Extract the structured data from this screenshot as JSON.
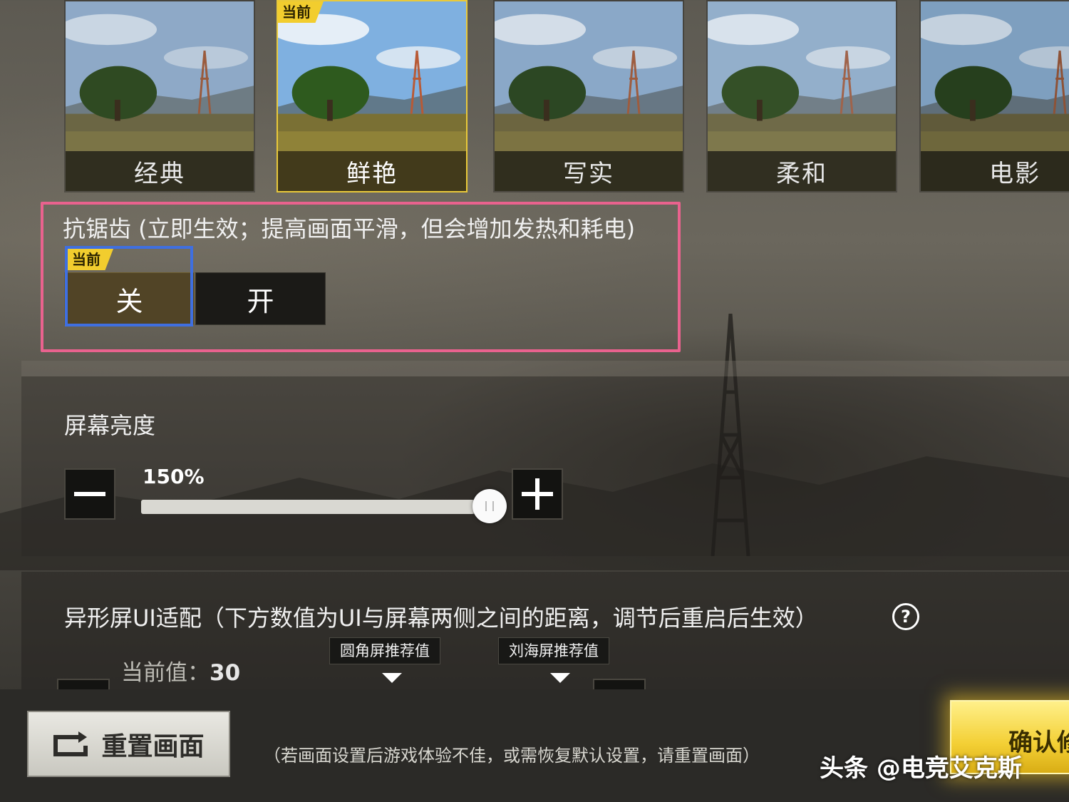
{
  "presets": {
    "current_tag": "当前",
    "items": [
      {
        "label": "经典",
        "selected": false
      },
      {
        "label": "鲜艳",
        "selected": true
      },
      {
        "label": "写实",
        "selected": false
      },
      {
        "label": "柔和",
        "selected": false
      },
      {
        "label": "电影",
        "selected": false
      }
    ]
  },
  "antialias": {
    "title": "抗锯齿 (立即生效；提高画面平滑，但会增加发热和耗电)",
    "current_tag": "当前",
    "off_label": "关",
    "on_label": "开",
    "selected": "off"
  },
  "brightness": {
    "title": "屏幕亮度",
    "value_label": "150%",
    "level_fraction": 0.95
  },
  "notch": {
    "title": "异形屏UI适配（下方数值为UI与屏幕两侧之间的距离，调节后重启后生效）",
    "help_icon": "?",
    "current_label": "当前值：",
    "current_value": "30",
    "rounded_rec": "圆角屏推荐值",
    "notch_rec": "刘海屏推荐值"
  },
  "footer": {
    "reset_label": "重置画面",
    "reset_note": "（若画面设置后游戏体验不佳，或需恢复默认设置，请重置画面）",
    "confirm_label": "确认修",
    "watermark": "头条 @电竞艾克斯"
  },
  "colors": {
    "accent_yellow": "#f2cd2e",
    "highlight_pink": "#e9628e",
    "highlight_blue": "#3f6fe0"
  }
}
